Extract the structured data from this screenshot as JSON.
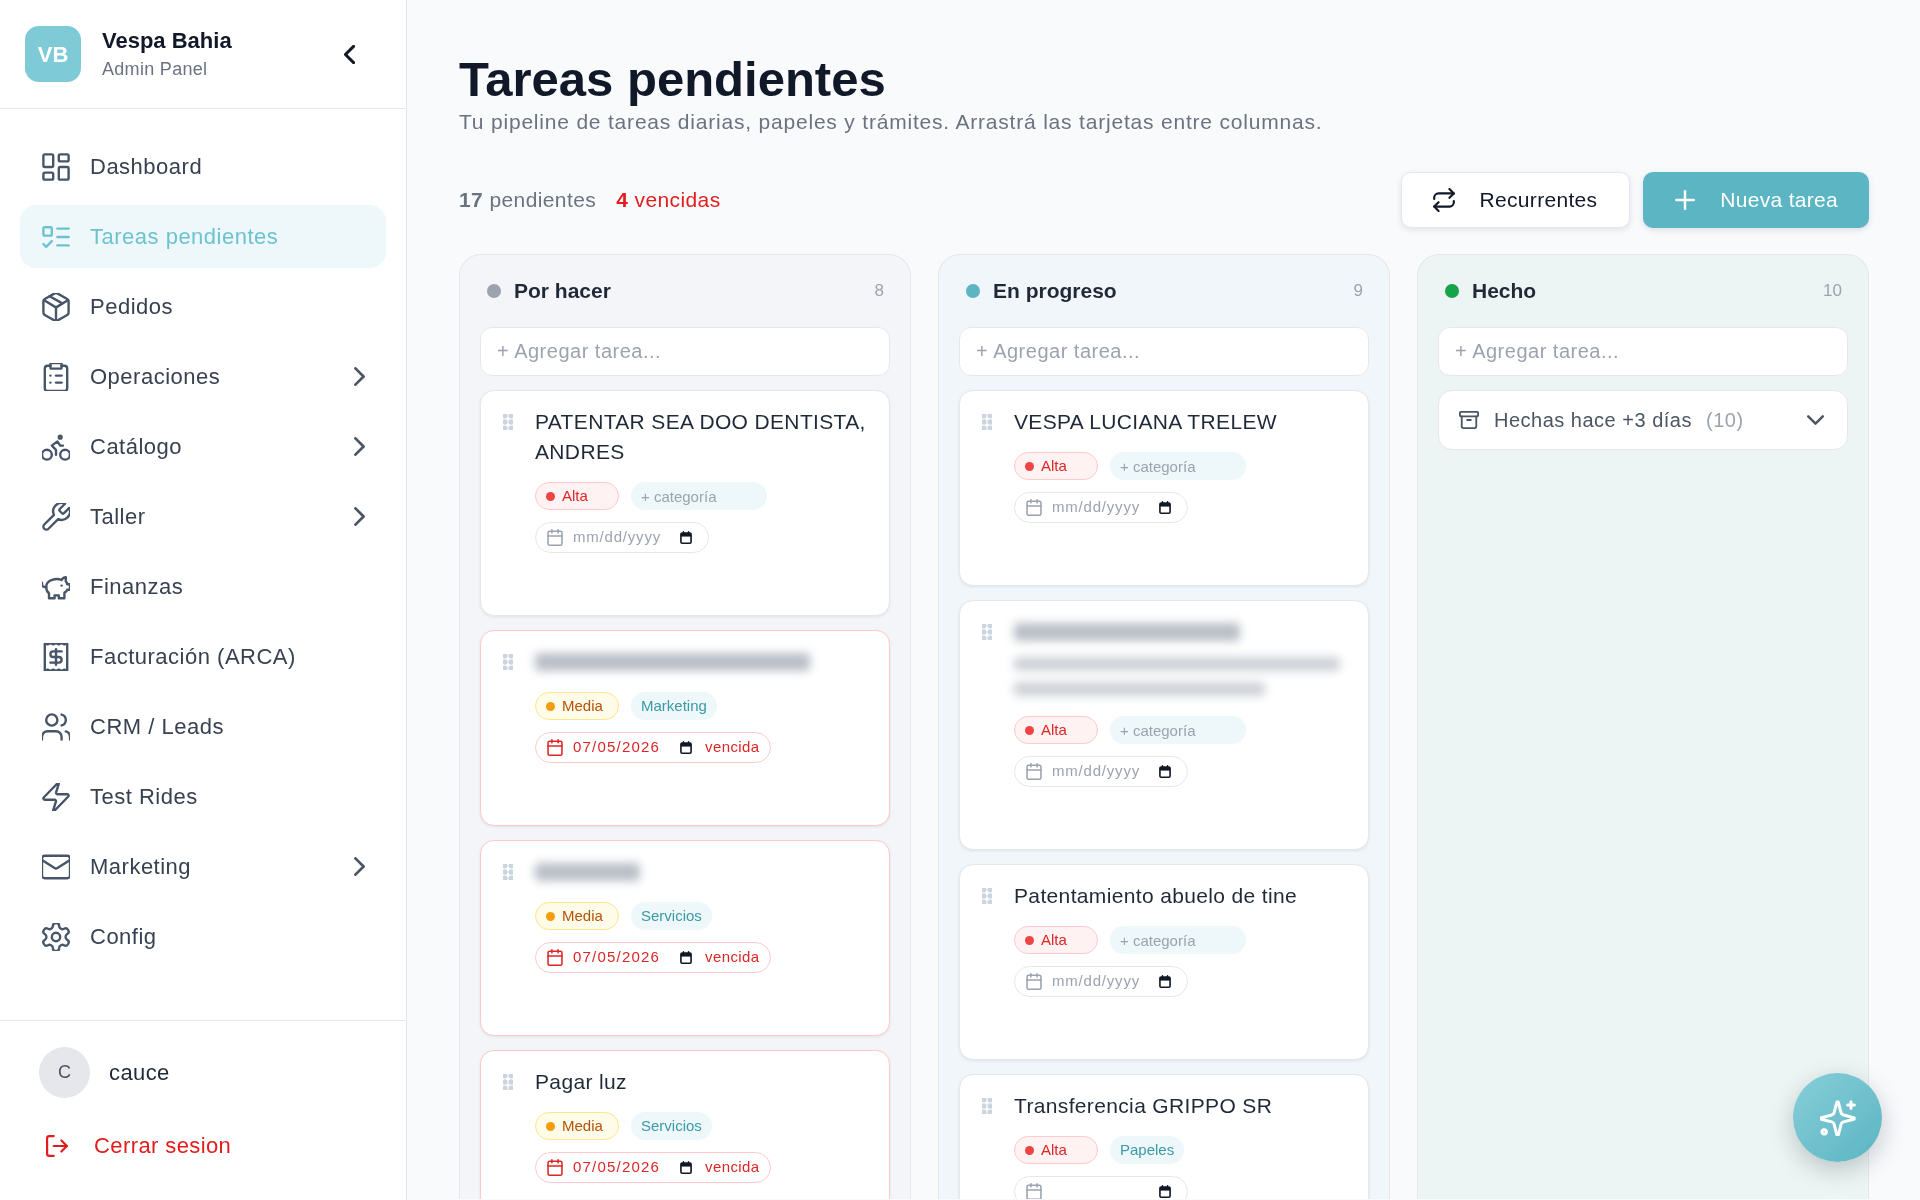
{
  "sidebar": {
    "brand": {
      "initials": "VB",
      "name": "Vespa Bahia",
      "subtitle": "Admin Panel"
    },
    "items": [
      {
        "label": "Dashboard",
        "selected": false,
        "has_submenu": false
      },
      {
        "label": "Tareas pendientes",
        "selected": true,
        "has_submenu": false
      },
      {
        "label": "Pedidos",
        "selected": false,
        "has_submenu": false
      },
      {
        "label": "Operaciones",
        "selected": false,
        "has_submenu": true
      },
      {
        "label": "Catálogo",
        "selected": false,
        "has_submenu": true
      },
      {
        "label": "Taller",
        "selected": false,
        "has_submenu": true
      },
      {
        "label": "Finanzas",
        "selected": false,
        "has_submenu": false
      },
      {
        "label": "Facturación (ARCA)",
        "selected": false,
        "has_submenu": false
      },
      {
        "label": "CRM / Leads",
        "selected": false,
        "has_submenu": false
      },
      {
        "label": "Test Rides",
        "selected": false,
        "has_submenu": false
      },
      {
        "label": "Marketing",
        "selected": false,
        "has_submenu": true
      },
      {
        "label": "Config",
        "selected": false,
        "has_submenu": false
      }
    ],
    "user": {
      "initial": "C",
      "name": "cauce"
    },
    "logout": "Cerrar sesion"
  },
  "page": {
    "title": "Tareas pendientes",
    "subtitle": "Tu pipeline de tareas diarias, papeles y trámites. Arrastrá las tarjetas entre columnas.",
    "pending": "**17** pendientes",
    "overdue": "**4** vencidas",
    "buttons": [
      {
        "label": "Recurrentes",
        "kind": "secondary"
      },
      {
        "label": "Nueva tarea",
        "kind": "primary"
      }
    ]
  },
  "columns": [
    {
      "title": "Por hacer",
      "count": "8",
      "color": "#9ca3af",
      "add_placeholder": "+ Agregar tarea...",
      "cards": [
        {
          "title": "PATENTAR SEA DOO DENTISTA, ANDRES",
          "title_blurred": false,
          "description_blurred": false,
          "overdue": false,
          "priority": {
            "label": "Alta",
            "kind": "high"
          },
          "category": {
            "placeholder": "+ categoría"
          },
          "date": {
            "placeholder": "mm/dd/yyyy"
          }
        },
        {
          "title_blurred": true,
          "description_blurred": false,
          "overdue": true,
          "priority": {
            "label": "Media",
            "kind": "medium"
          },
          "category": {
            "value": "Marketing"
          },
          "date": {
            "value": "07/05/2026",
            "status": "vencida"
          }
        },
        {
          "title_blurred": true,
          "description_blurred": false,
          "overdue": true,
          "priority": {
            "label": "Media",
            "kind": "medium"
          },
          "category": {
            "value": "Servicios"
          },
          "date": {
            "value": "07/05/2026",
            "status": "vencida"
          }
        },
        {
          "title": "Pagar luz",
          "title_blurred": false,
          "description_blurred": false,
          "overdue": true,
          "priority": {
            "label": "Media",
            "kind": "medium"
          },
          "category": {
            "value": "Servicios"
          },
          "date": {
            "value": "07/05/2026",
            "status": "vencida"
          }
        }
      ]
    },
    {
      "title": "En progreso",
      "count": "9",
      "color": "#5bb5c3",
      "add_placeholder": "+ Agregar tarea...",
      "cards": [
        {
          "title": "VESPA LUCIANA TRELEW",
          "title_blurred": false,
          "description_blurred": false,
          "overdue": false,
          "priority": {
            "label": "Alta",
            "kind": "high"
          },
          "category": {
            "placeholder": "+ categoría"
          },
          "date": {
            "placeholder": "mm/dd/yyyy"
          }
        },
        {
          "title_blurred": true,
          "description_blurred": true,
          "overdue": false,
          "priority": {
            "label": "Alta",
            "kind": "high"
          },
          "category": {
            "placeholder": "+ categoría"
          },
          "date": {
            "placeholder": "mm/dd/yyyy"
          }
        },
        {
          "title": "Patentamiento abuelo de tine",
          "title_blurred": false,
          "description_blurred": false,
          "overdue": false,
          "priority": {
            "label": "Alta",
            "kind": "high"
          },
          "category": {
            "placeholder": "+ categoría"
          },
          "date": {
            "placeholder": "mm/dd/yyyy"
          }
        },
        {
          "title": "Transferencia GRIPPO SR",
          "title_blurred": false,
          "description_blurred": false,
          "overdue": false,
          "priority": {
            "label": "Alta",
            "kind": "high"
          },
          "category": {
            "value": "Papeles"
          }
        }
      ]
    },
    {
      "title": "Hecho",
      "count": "10",
      "color": "#16a34a",
      "add_placeholder": "+ Agregar tarea...",
      "archive": {
        "label": "Hechas hace +3 días",
        "count": "(10)",
        "expanded": false
      }
    }
  ]
}
